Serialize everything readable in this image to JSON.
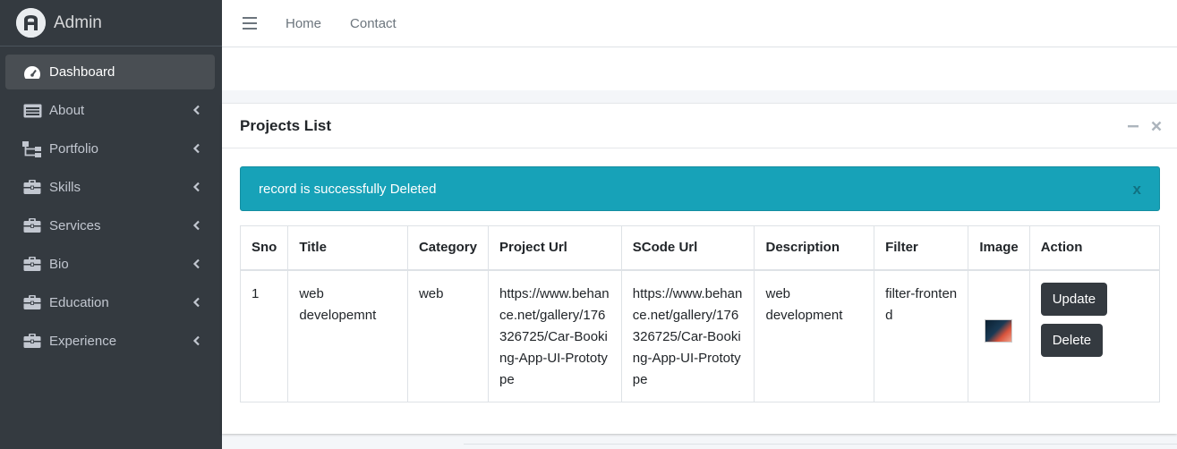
{
  "brand": {
    "name": "Admin",
    "logo_letter": "A"
  },
  "sidebar": {
    "items": [
      {
        "label": "Dashboard",
        "icon": "tachometer-icon",
        "active": true
      },
      {
        "label": "About",
        "icon": "id-card-icon"
      },
      {
        "label": "Portfolio",
        "icon": "sitemap-icon"
      },
      {
        "label": "Skills",
        "icon": "briefcase-icon"
      },
      {
        "label": "Services",
        "icon": "briefcase-icon"
      },
      {
        "label": "Bio",
        "icon": "briefcase-icon"
      },
      {
        "label": "Education",
        "icon": "briefcase-icon"
      },
      {
        "label": "Experience",
        "icon": "briefcase-icon"
      }
    ]
  },
  "topbar": {
    "home": "Home",
    "contact": "Contact"
  },
  "card": {
    "title": "Projects List",
    "alert": {
      "message": "record is successfully Deleted",
      "close": "x"
    }
  },
  "table": {
    "headers": [
      "Sno",
      "Title",
      "Category",
      "Project Url",
      "SCode Url",
      "Description",
      "Filter",
      "Image",
      "Action"
    ],
    "rows": [
      {
        "sno": "1",
        "title": "web developemnt",
        "category": "web",
        "project_url": "https://www.behance.net/gallery/176326725/Car-Booking-App-UI-Prototype",
        "scode_url": "https://www.behance.net/gallery/176326725/Car-Booking-App-UI-Prototype",
        "description": "web development",
        "filter": "filter-frontend",
        "update": "Update",
        "delete": "Delete"
      }
    ]
  },
  "colors": {
    "sidebar": "#343a40",
    "alert": "#17a2b8",
    "button": "#343a40"
  }
}
